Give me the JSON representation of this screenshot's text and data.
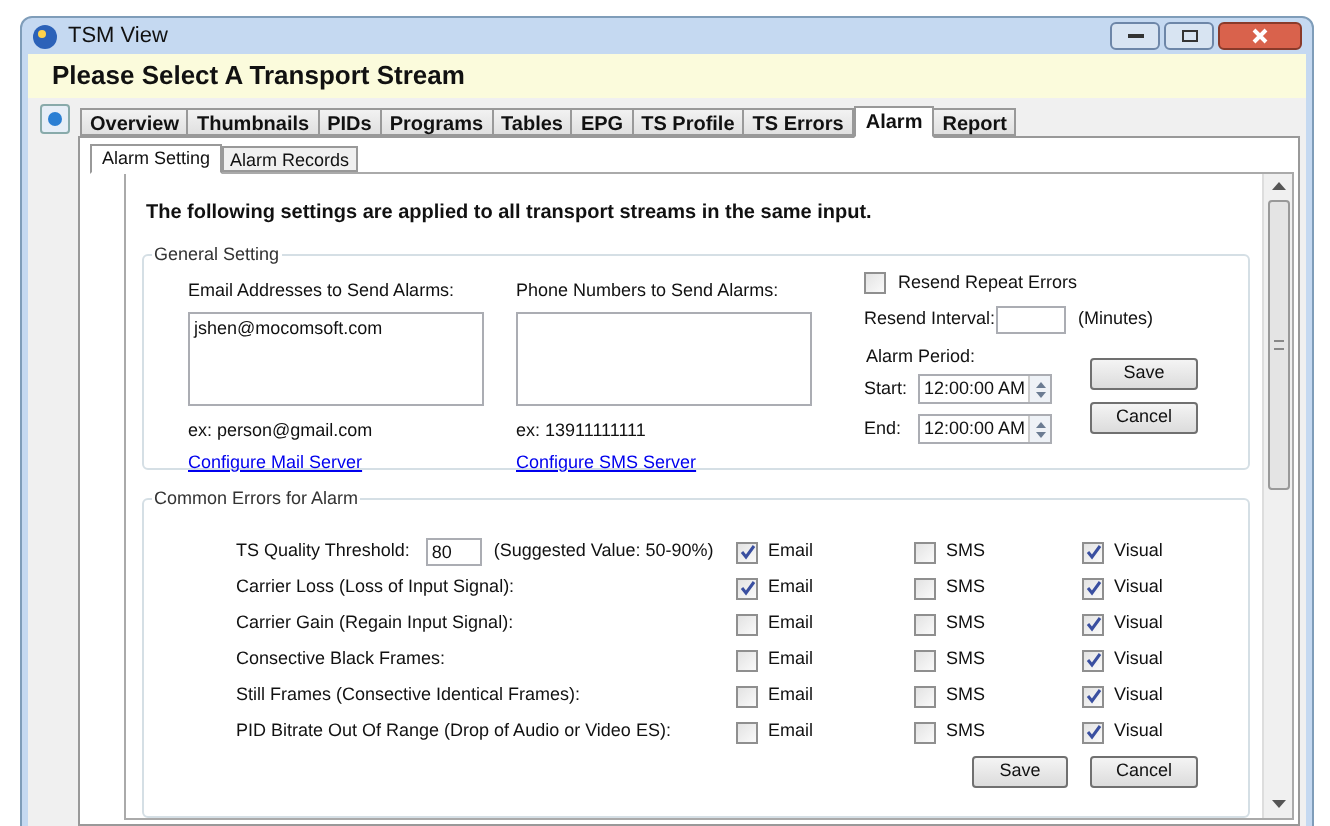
{
  "window": {
    "title": "TSM View"
  },
  "banner": "Please Select A Transport Stream",
  "tabs": [
    {
      "label": "Overview",
      "selected": false
    },
    {
      "label": "Thumbnails",
      "selected": false
    },
    {
      "label": "PIDs",
      "selected": false
    },
    {
      "label": "Programs",
      "selected": false
    },
    {
      "label": "Tables",
      "selected": false
    },
    {
      "label": "EPG",
      "selected": false
    },
    {
      "label": "TS Profile",
      "selected": false
    },
    {
      "label": "TS Errors",
      "selected": false
    },
    {
      "label": "Alarm",
      "selected": true
    },
    {
      "label": "Report",
      "selected": false
    }
  ],
  "subtabs": [
    {
      "label": "Alarm Setting",
      "selected": true
    },
    {
      "label": "Alarm Records",
      "selected": false
    }
  ],
  "notice": "The following settings are applied to all transport streams in the same input.",
  "general": {
    "title": "General Setting",
    "email": {
      "label": "Email Addresses to Send Alarms:",
      "value": "jshen@mocomsoft.com",
      "example": "ex: person@gmail.com",
      "link": "Configure Mail Server"
    },
    "phone": {
      "label": "Phone Numbers to Send Alarms:",
      "example": "ex: 13911111111",
      "link": "Configure SMS Server"
    },
    "resend": {
      "label": "Resend Repeat Errors",
      "checked": false
    },
    "interval": {
      "label": "Resend Interval:",
      "unit": "(Minutes)"
    },
    "period": {
      "label": "Alarm Period:",
      "start": {
        "label": "Start:",
        "value": "12:00:00 AM"
      },
      "end": {
        "label": "End:",
        "value": "12:00:00 AM"
      }
    },
    "buttons": [
      "Save",
      "Cancel"
    ]
  },
  "errors": {
    "title": "Common Errors for Alarm",
    "rows": [
      {
        "label": "TS Quality Threshold:",
        "value": "80",
        "hint": "(Suggested Value: 50-90%)",
        "channels": [
          {
            "label": "Email",
            "checked": true
          },
          {
            "label": "SMS",
            "checked": false
          },
          {
            "label": "Visual",
            "checked": true
          }
        ]
      },
      {
        "label": "Carrier Loss (Loss of Input Signal):",
        "channels": [
          {
            "label": "Email",
            "checked": true
          },
          {
            "label": "SMS",
            "checked": false
          },
          {
            "label": "Visual",
            "checked": true
          }
        ]
      },
      {
        "label": "Carrier Gain (Regain Input Signal):",
        "channels": [
          {
            "label": "Email",
            "checked": false
          },
          {
            "label": "SMS",
            "checked": false
          },
          {
            "label": "Visual",
            "checked": true
          }
        ]
      },
      {
        "label": "Consective Black Frames:",
        "channels": [
          {
            "label": "Email",
            "checked": false
          },
          {
            "label": "SMS",
            "checked": false
          },
          {
            "label": "Visual",
            "checked": true
          }
        ]
      },
      {
        "label": "Still Frames (Consective Identical Frames):",
        "channels": [
          {
            "label": "Email",
            "checked": false
          },
          {
            "label": "SMS",
            "checked": false
          },
          {
            "label": "Visual",
            "checked": true
          }
        ]
      },
      {
        "label": "PID Bitrate Out Of Range (Drop of Audio or Video ES):",
        "channels": [
          {
            "label": "Email",
            "checked": false
          },
          {
            "label": "SMS",
            "checked": false
          },
          {
            "label": "Visual",
            "checked": true
          }
        ]
      }
    ],
    "buttons": [
      "Save",
      "Cancel"
    ]
  }
}
